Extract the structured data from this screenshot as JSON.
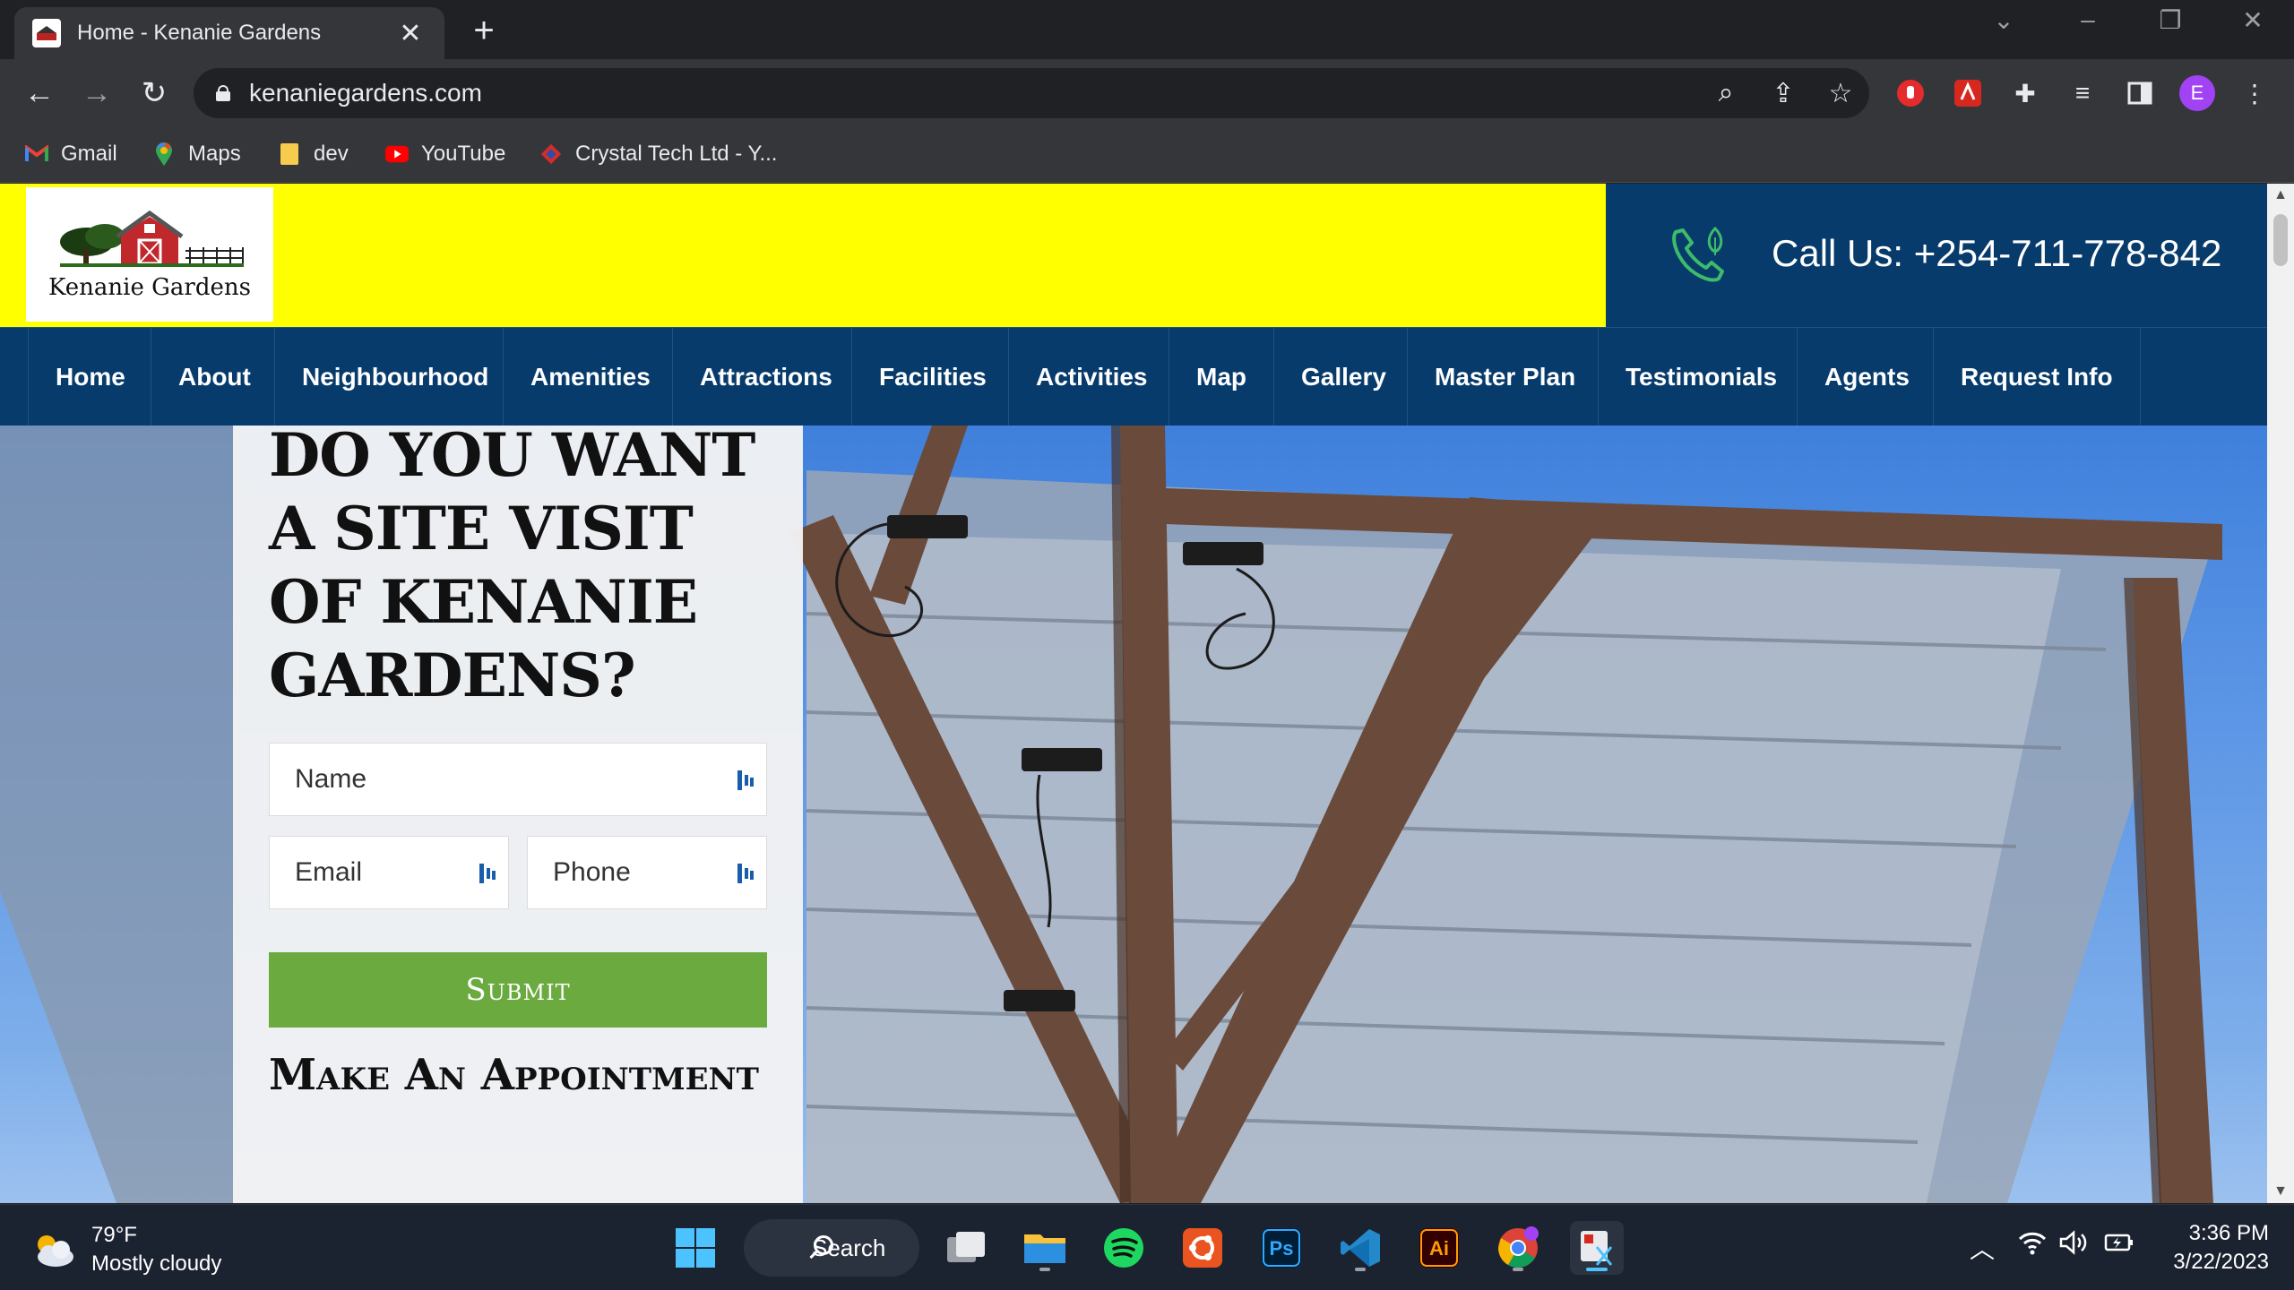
{
  "browser": {
    "tab_title": "Home - Kenanie Gardens",
    "url": "kenaniegardens.com",
    "profile_initial": "E",
    "bookmarks": [
      {
        "label": "Gmail",
        "icon": "gmail-icon"
      },
      {
        "label": "Maps",
        "icon": "maps-icon"
      },
      {
        "label": "dev",
        "icon": "folder-icon"
      },
      {
        "label": "YouTube",
        "icon": "youtube-icon"
      },
      {
        "label": "Crystal Tech Ltd - Y...",
        "icon": "crystal-tech-icon"
      }
    ]
  },
  "site": {
    "logo_text": "Kenanie Gardens",
    "call_text": "Call Us: +254-711-778-842",
    "nav": [
      "Home",
      "About",
      "Neighbourhood",
      "Amenities",
      "Attractions",
      "Facilities",
      "Activities",
      "Map",
      "Gallery",
      "Master Plan",
      "Testimonials",
      "Agents",
      "Request Info"
    ],
    "form": {
      "heading": "Do you want a site visit of Kenanie Gardens?",
      "name_placeholder": "Name",
      "email_placeholder": "Email",
      "phone_placeholder": "Phone",
      "submit_label": "Submit",
      "subheading": "Make An Appointment"
    }
  },
  "taskbar": {
    "weather_temp": "79°F",
    "weather_desc": "Mostly cloudy",
    "search_label": "Search",
    "time": "3:36 PM",
    "date": "3/22/2023"
  },
  "colors": {
    "header_yellow": "#ffff00",
    "nav_blue": "#073b6b",
    "submit_green": "#6aaa3f",
    "sky_blue": "#4f8de0"
  }
}
